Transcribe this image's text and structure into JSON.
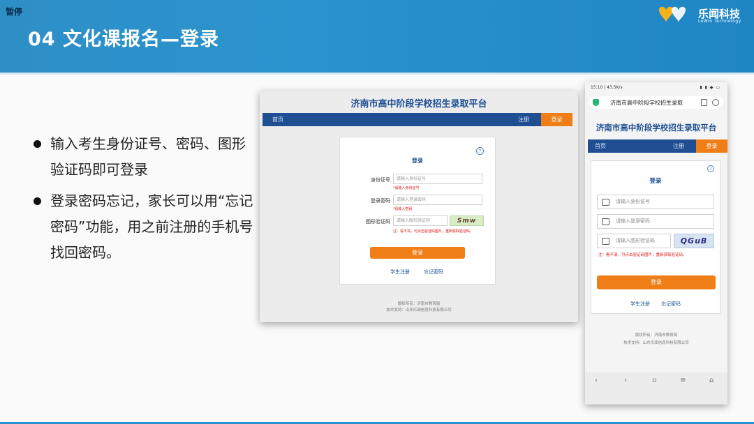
{
  "slide": {
    "pause_label": "暂停",
    "title": "04 文化课报名—登录",
    "logo": {
      "brand": "乐闻科技",
      "sub": "LeWin Technology"
    },
    "bullets": [
      "输入考生身份证号、密码、图形验证码即可登录",
      "登录密码忘记，家长可以用“忘记密码”功能，用之前注册的手机号找回密码。"
    ]
  },
  "desktop": {
    "page_title": "济南市高中阶段学校招生录取平台",
    "nav": {
      "home": "首页",
      "register": "注册",
      "login": "登录"
    },
    "card": {
      "title": "登录",
      "help_icon": "?",
      "fields": [
        {
          "label": "身份证号",
          "placeholder": "请输入身份证号",
          "error": "*请输入身份证号"
        },
        {
          "label": "登录密码",
          "placeholder": "请输入登录密码",
          "error": "*请输入密码"
        },
        {
          "label": "图形验证码",
          "placeholder": "请输入图形验证码"
        }
      ],
      "captcha_text": "Smw",
      "captcha_note": "注：看不清，可点击验证码图片，重新获取验证码。",
      "login_button": "登录",
      "link_register": "学生注册",
      "link_forgot": "忘记密码"
    },
    "footer": {
      "copyright": "版权所有：济南市教育局",
      "support": "技术支持：山东乐闻信息科技有限公司"
    }
  },
  "mobile": {
    "status_time": "15:10 | 43.5K/s",
    "status_right": "▮ ▮ ◆ ▭",
    "url": "济南市高中阶段学校招生录取",
    "page_title": "济南市高中阶段学校招生录取平台",
    "nav": {
      "home": "首页",
      "register": "注册",
      "login": "登录"
    },
    "card": {
      "title": "登录",
      "help_icon": "?",
      "fields": [
        {
          "placeholder": "请输入身份证号"
        },
        {
          "placeholder": "请输入登录密码"
        },
        {
          "placeholder": "请输入图形验证码"
        }
      ],
      "captcha_text": "QGuB",
      "captcha_note": "注：看不清，可点击验证码图片，重新获取验证码。",
      "login_button": "登录",
      "link_register": "学生注册",
      "link_forgot": "忘记密码"
    },
    "footer": {
      "copyright": "版权所有：济南市教育局",
      "support": "技术支持：山东乐闻信息科技有限公司"
    },
    "bottom_icons": [
      "back-icon",
      "forward-icon",
      "tabs-icon",
      "menu-icon",
      "home-icon"
    ]
  },
  "colors": {
    "header_blue": "#2a93cf",
    "nav_blue": "#1f4f92",
    "accent_orange": "#f07e16",
    "error_red": "#dd1111"
  }
}
